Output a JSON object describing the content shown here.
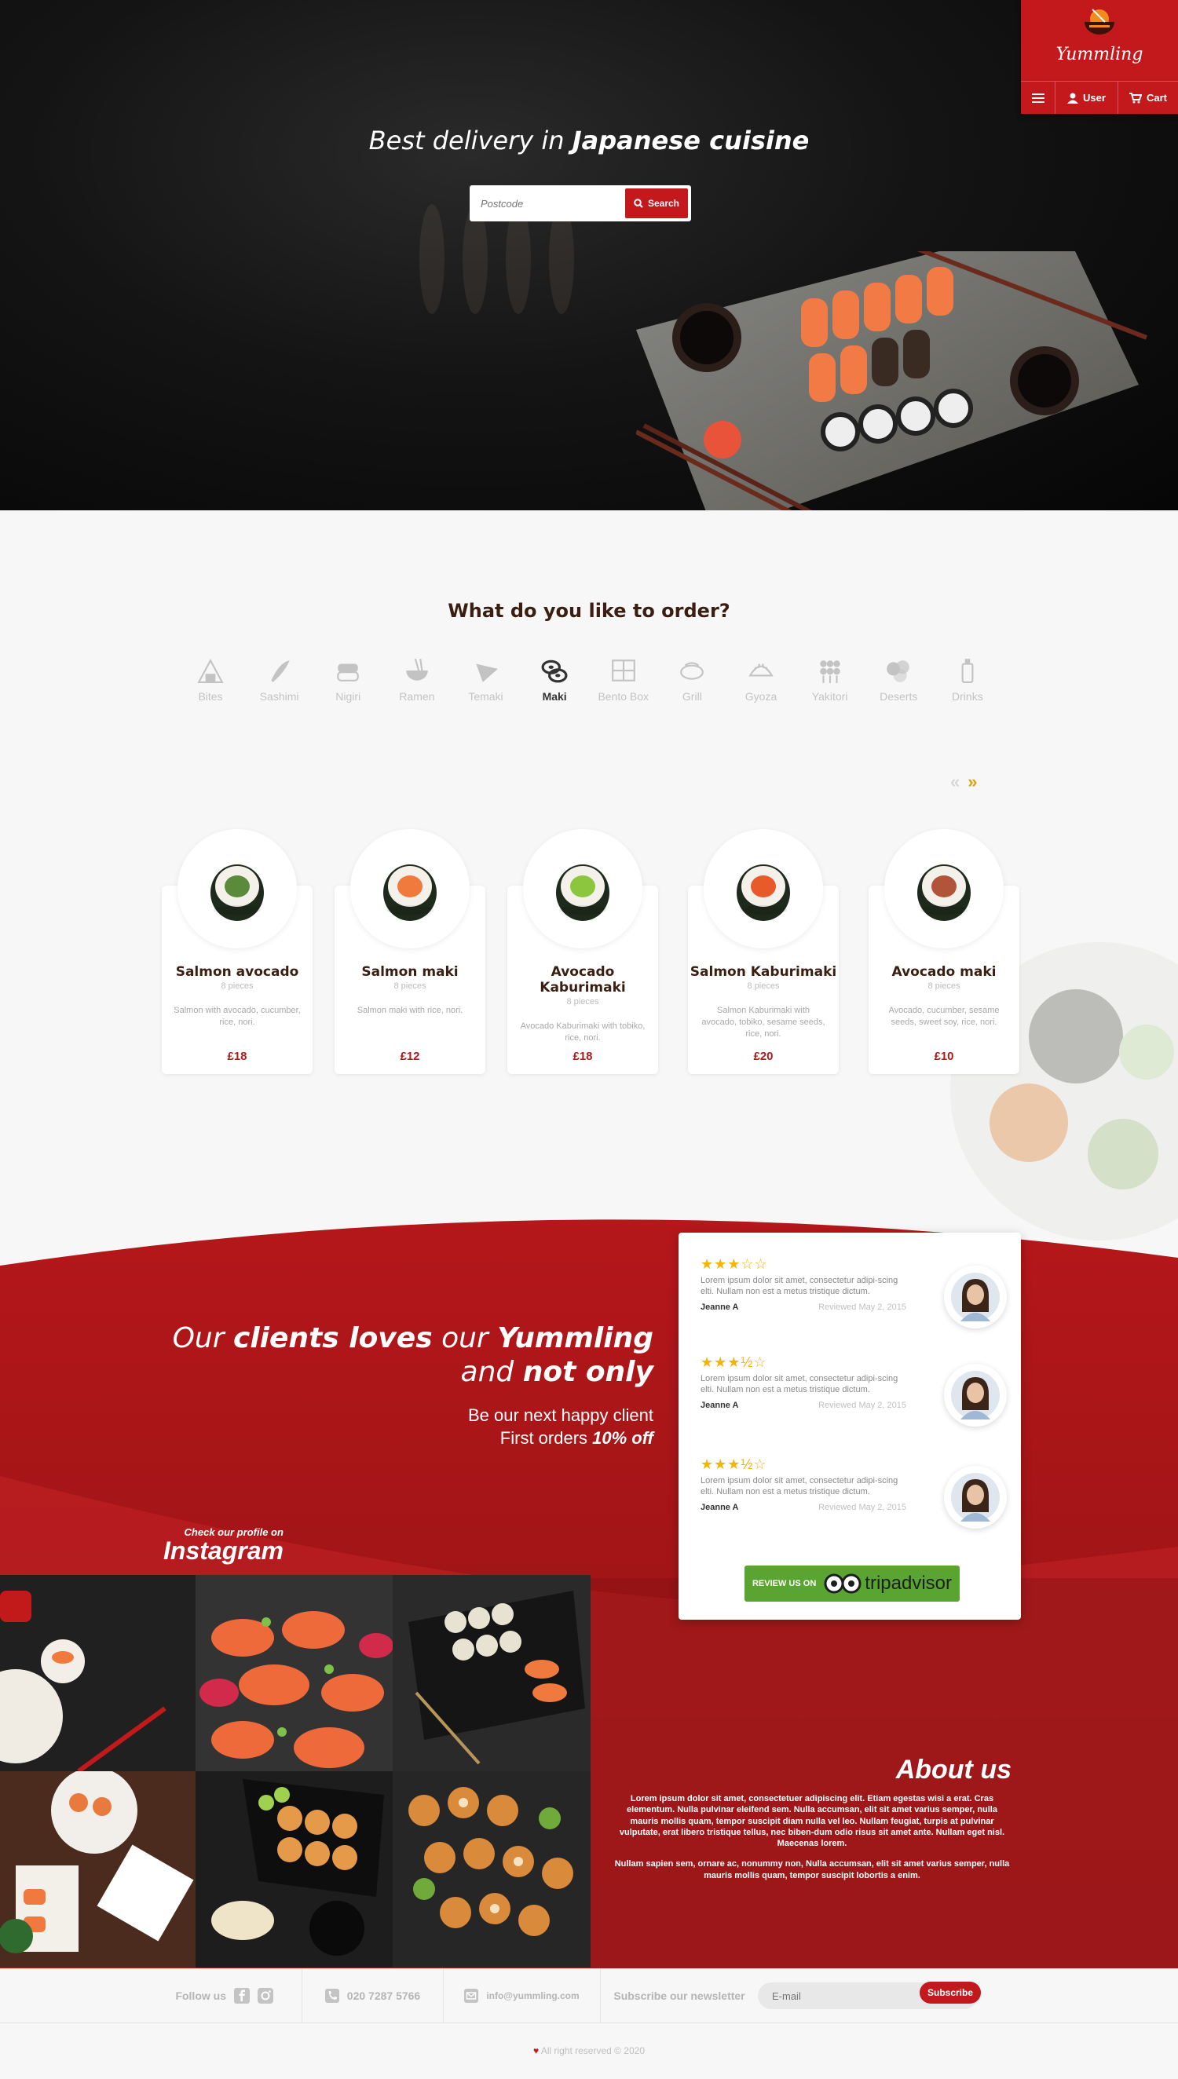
{
  "hero": {
    "title_prefix": "Best delivery in",
    "title_bold": "Japanese cuisine",
    "search_placeholder": "Postcode",
    "search_label": "Search"
  },
  "brand": {
    "name": "Yummling",
    "nav": {
      "user": "User",
      "cart": "Cart"
    }
  },
  "order": {
    "title": "What do you like to order?",
    "categories": [
      {
        "label": "Bites",
        "icon": "onigiri-icon"
      },
      {
        "label": "Sashimi",
        "icon": "sashimi-icon"
      },
      {
        "label": "Nigiri",
        "icon": "nigiri-icon"
      },
      {
        "label": "Ramen",
        "icon": "ramen-bowl-icon"
      },
      {
        "label": "Temaki",
        "icon": "temaki-icon"
      },
      {
        "label": "Maki",
        "icon": "maki-icon"
      },
      {
        "label": "Bento Box",
        "icon": "bento-box-icon"
      },
      {
        "label": "Grill",
        "icon": "grill-icon"
      },
      {
        "label": "Gyoza",
        "icon": "gyoza-icon"
      },
      {
        "label": "Yakitori",
        "icon": "yakitori-icon"
      },
      {
        "label": "Deserts",
        "icon": "desserts-icon"
      },
      {
        "label": "Drinks",
        "icon": "drinks-icon"
      }
    ],
    "active_category": "Maki",
    "prev": "«",
    "next": "»",
    "products": [
      {
        "name": "Salmon avocado",
        "pieces": "8 pieces",
        "desc": "Salmon with avocado, cucumber, rice, nori.",
        "price": "£18",
        "fill": "#5a8a3a"
      },
      {
        "name": "Salmon maki",
        "pieces": "8 pieces",
        "desc": "Salmon maki with rice, nori.",
        "price": "£12",
        "fill": "#f07a3e"
      },
      {
        "name": "Avocado Kaburimaki",
        "pieces": "8 pieces",
        "desc": "Avocado Kaburimaki with tobiko, rice, nori.",
        "price": "£18",
        "fill": "#8cc63f"
      },
      {
        "name": "Salmon Kaburimaki",
        "pieces": "8 pieces",
        "desc": "Salmon Kaburimaki with avocado, tobiko, sesame seeds, rice, nori.",
        "price": "£20",
        "fill": "#e85a2a"
      },
      {
        "name": "Avocado maki",
        "pieces": "8 pieces",
        "desc": "Avocado, cucumber, sesame seeds, sweet soy, rice, nori.",
        "price": "£10",
        "fill": "#b0553a"
      }
    ]
  },
  "clients": {
    "line1_a": "Our ",
    "line1_b": "clients loves",
    "line1_c": " our ",
    "line1_d": "Yummling",
    "line2_a": "and ",
    "line2_b": "not only",
    "sub1": "Be our next happy client",
    "sub2_a": "First orders ",
    "sub2_b": "10% off"
  },
  "reviews": [
    {
      "stars": "★★★☆☆",
      "text": "Lorem ipsum dolor sit amet, consectetur adipi-scing elti. Nullam non est a metus tristique dictum.",
      "author": "Jeanne A",
      "date": "Reviewed May 2, 2015"
    },
    {
      "stars": "★★★½☆",
      "text": "Lorem ipsum dolor sit amet, consectetur adipi-scing elti. Nullam non est a metus tristique dictum.",
      "author": "Jeanne A",
      "date": "Reviewed May 2, 2015"
    },
    {
      "stars": "★★★½☆",
      "text": "Lorem ipsum dolor sit amet, consectetur adipi-scing elti. Nullam non est a metus tristique dictum.",
      "author": "Jeanne A",
      "date": "Reviewed May 2, 2015"
    }
  ],
  "tripadvisor": {
    "review_label": "REVIEW US ON",
    "brand": "tripadvisor"
  },
  "instagram": {
    "small": "Check our profile on",
    "title": "Instagram"
  },
  "about": {
    "title": "About us",
    "p1": "Lorem ipsum dolor sit amet, consectetuer adipiscing elit. Etiam egestas wisi a erat. Cras elementum. Nulla pulvinar eleifend sem. Nulla accumsan, elit sit amet varius semper, nulla mauris mollis quam, tempor suscipit diam nulla vel leo. Nullam feugiat, turpis at pulvinar vulputate, erat libero tristique tellus, nec biben-dum odio risus sit amet ante. Nullam eget nisl. Maecenas lorem.",
    "p2": "Nullam sapien sem, ornare ac, nonummy non, Nulla accumsan, elit sit amet varius semper, nulla mauris mollis quam, tempor suscipit lobortis a enim."
  },
  "footer": {
    "follow": "Follow us",
    "phone": "020 7287 5766",
    "email": "info@yummling.com",
    "newsletter": "Subscribe our newsletter",
    "email_placeholder": "E-mail",
    "subscribe": "Subscribe",
    "copyright": "All right reserved © 2020"
  },
  "colors": {
    "brand_red": "#c3191d",
    "price_red": "#b01a1c",
    "star": "#f4b400",
    "trip_green": "#5aa531"
  }
}
